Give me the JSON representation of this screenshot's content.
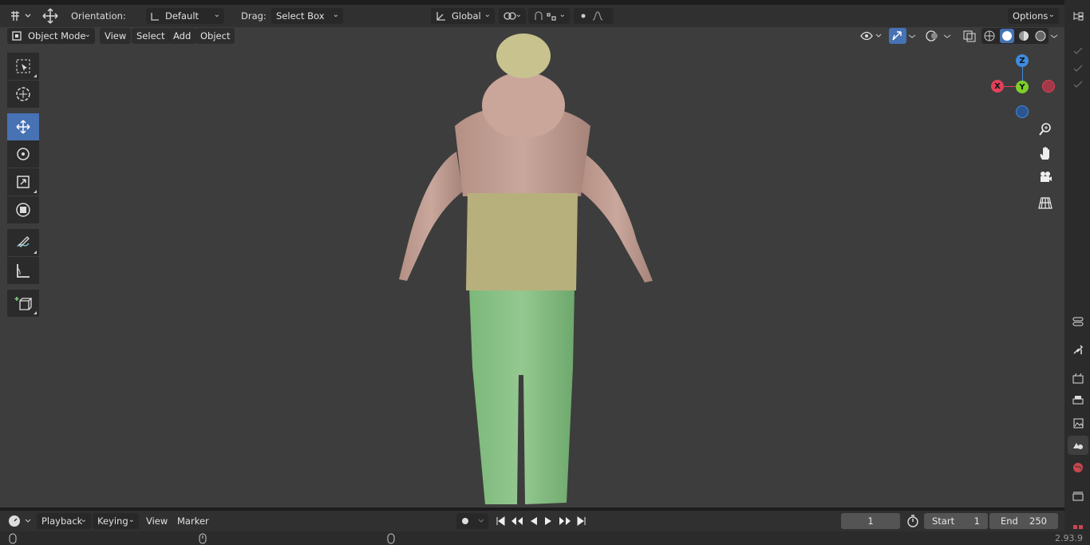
{
  "tool_header": {
    "orientation_label": "Orientation:",
    "orientation_value": "Default",
    "drag_label": "Drag:",
    "drag_value": "Select Box",
    "transform_space": "Global",
    "options_label": "Options"
  },
  "view_header": {
    "mode": "Object Mode",
    "menus": [
      "View",
      "Select",
      "Add",
      "Object"
    ]
  },
  "gizmo": {
    "z": "Z",
    "x": "X",
    "y": "Y"
  },
  "timeline": {
    "menus": [
      "Playback",
      "Keying",
      "View",
      "Marker"
    ],
    "current_frame": "1",
    "start_label": "Start",
    "start_value": "1",
    "end_label": "End",
    "end_value": "250"
  },
  "status": {
    "version": "2.93.9"
  },
  "colors": {
    "accent": "#4772b3",
    "x_axis": "#e0415a",
    "y_axis": "#7fcf2a",
    "z_axis": "#3f8be0"
  }
}
